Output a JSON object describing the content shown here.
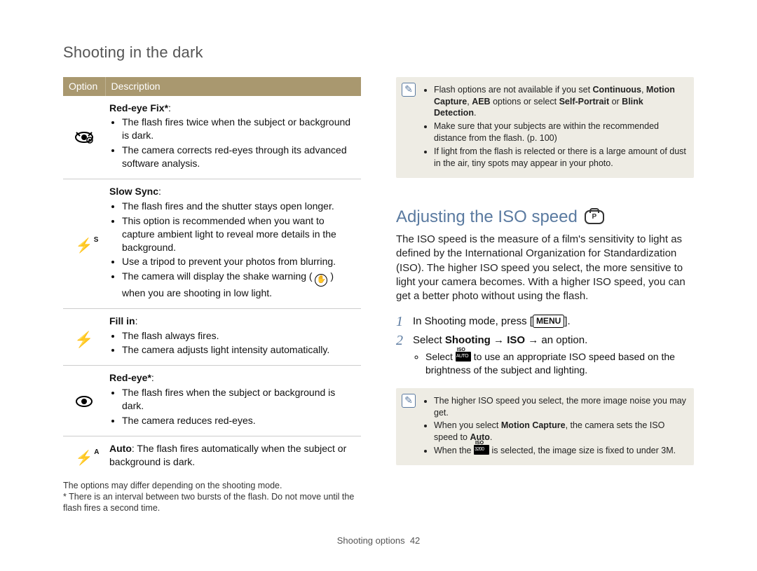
{
  "breadcrumb": "Shooting in the dark",
  "table": {
    "headers": {
      "option": "Option",
      "description": "Description"
    },
    "rows": [
      {
        "icon_name": "red-eye-fix-icon",
        "title": "Red-eye Fix*",
        "title_suffix": ":",
        "bullets": [
          "The flash fires twice when the subject or background is dark.",
          "The camera corrects red-eyes through its advanced software analysis."
        ]
      },
      {
        "icon_name": "slow-sync-icon",
        "title": "Slow Sync",
        "title_suffix": ":",
        "bullets": [
          "The flash fires and the shutter stays open longer.",
          "This option is recommended when you want to capture ambient light to reveal more details in the background.",
          "Use a tripod to prevent your photos from blurring.",
          "The camera will display the shake warning (   ) when you are shooting in low light."
        ],
        "inline_icon_index": 3
      },
      {
        "icon_name": "fill-in-icon",
        "title": "Fill in",
        "title_suffix": ":",
        "bullets": [
          "The flash always fires.",
          "The camera adjusts light intensity automatically."
        ]
      },
      {
        "icon_name": "red-eye-icon",
        "title": "Red-eye*",
        "title_suffix": ":",
        "bullets": [
          "The flash fires when the subject or background is dark.",
          "The camera reduces red-eyes."
        ]
      },
      {
        "icon_name": "auto-flash-icon",
        "inline_label": "Auto",
        "inline_text": ": The flash fires automatically when the subject or background is dark."
      }
    ]
  },
  "footnotes": [
    "The options may differ depending on the shooting mode.",
    "* There is an interval between two bursts of the flash. Do not move until the flash fires a second time."
  ],
  "note1": {
    "items": [
      {
        "prefix": "Flash options are not available if you set ",
        "bolds": [
          "Continuous",
          "Motion Capture",
          "AEB"
        ],
        "mid1": ", ",
        "mid2": ", ",
        "mid3": " options or select ",
        "bolds2": [
          "Self-Portrait",
          "Blink Detection"
        ],
        "sep": " or ",
        "suffix": "."
      },
      {
        "text": "Make sure that your subjects are within the recommended distance from the flash. (p. 100)"
      },
      {
        "text": "If light from the flash is relected or there is a large amount of dust in the air, tiny spots may appear in your photo."
      }
    ]
  },
  "section": {
    "heading": "Adjusting the ISO speed",
    "mode_badge": "P",
    "paragraph": "The ISO speed is the measure of a film's sensitivity to light as defined by the International Organization for Standardization (ISO). The higher ISO speed you select, the more sensitive to light your camera becomes. With a higher ISO speed, you can get a better photo without using the flash.",
    "steps": [
      {
        "pre": "In Shooting mode, press [",
        "btn": "MENU",
        "post": "]."
      },
      {
        "pre": "Select ",
        "bold": "Shooting",
        "arrow1": " → ",
        "bold2": "ISO",
        "arrow2": " → ",
        "post": "an option.",
        "sub": {
          "pre": "Select ",
          "icon": "iso-auto",
          "post": " to use an appropriate ISO speed based on the brightness of the subject and lighting."
        }
      }
    ]
  },
  "note2": {
    "items": [
      "The higher ISO speed you select, the more image noise you may get.",
      {
        "pre": "When you select ",
        "bold": "Motion Capture",
        "mid": ", the camera sets the ISO speed to ",
        "bold2": "Auto",
        "suffix": "."
      },
      {
        "pre": "When the ",
        "icon": "iso-3200",
        "post": " is selected, the image size is fixed to under 3M."
      }
    ]
  },
  "page_footer": {
    "label": "Shooting options",
    "num": "42"
  }
}
